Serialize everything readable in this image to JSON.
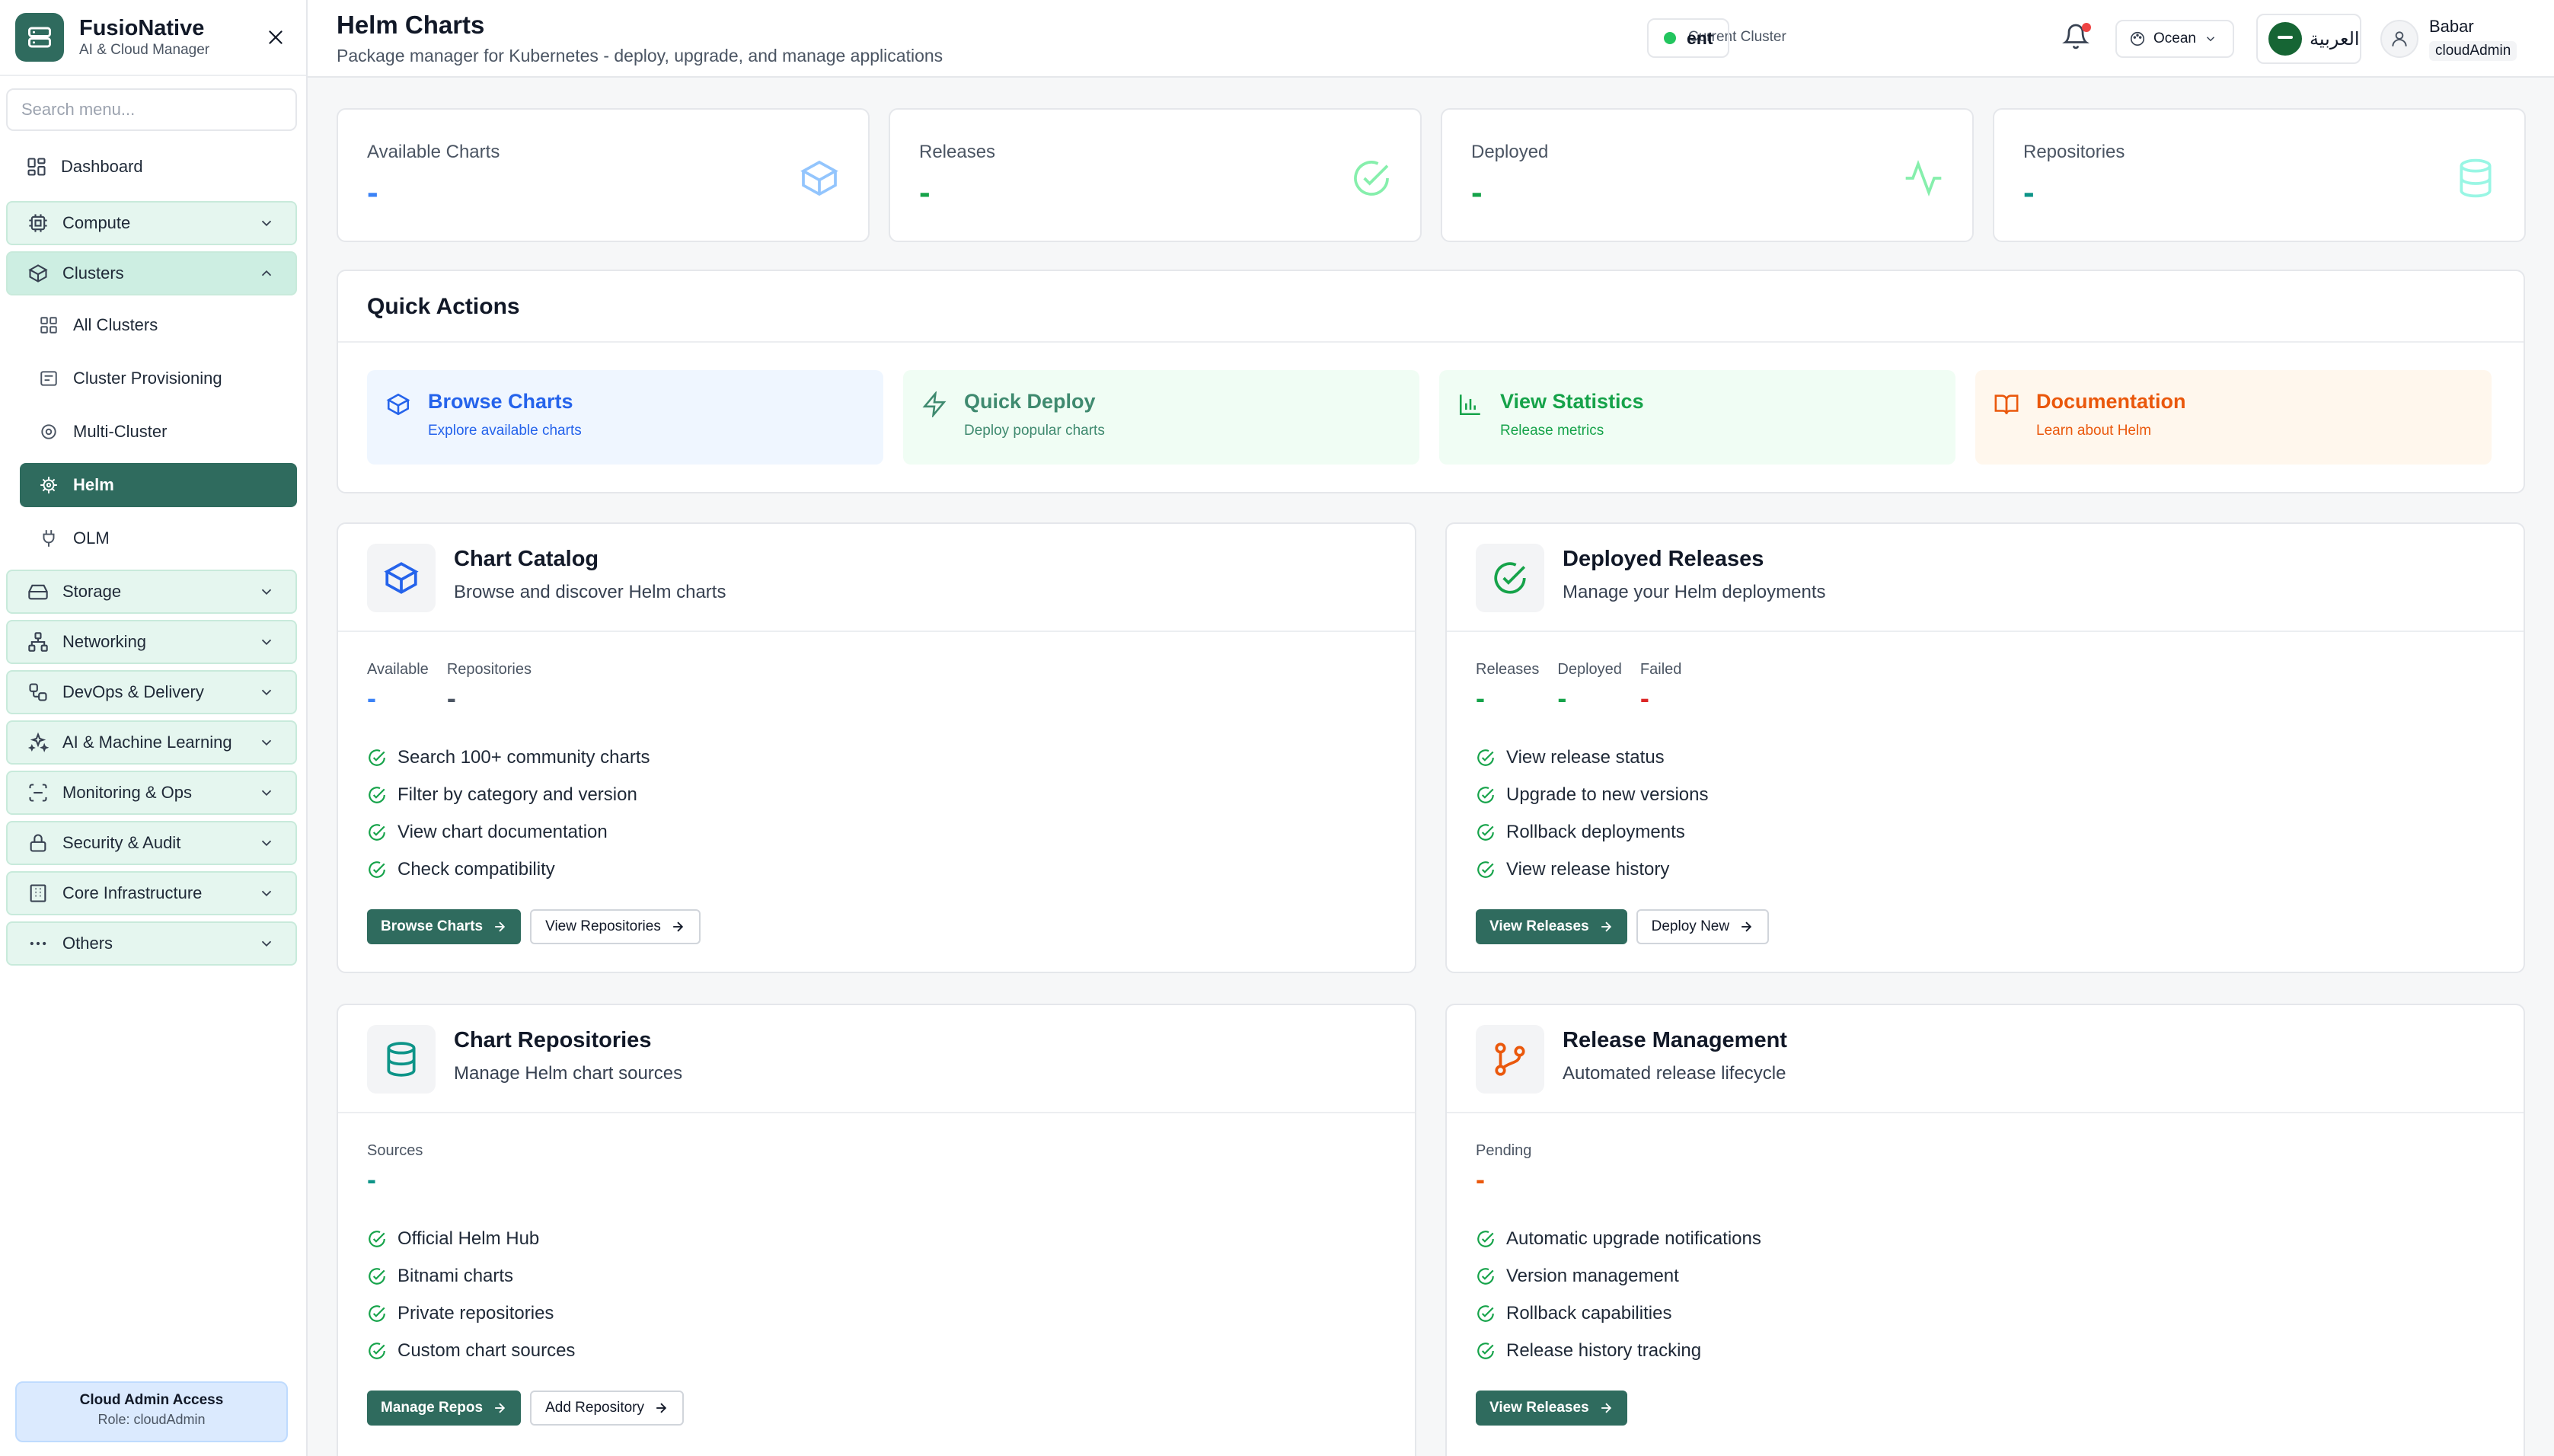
{
  "brand": {
    "name": "FusioNative",
    "subtitle": "AI & Cloud Manager"
  },
  "sidebar": {
    "search_placeholder": "Search menu...",
    "items": {
      "dashboard": "Dashboard",
      "compute": "Compute",
      "clusters": "Clusters",
      "all_clusters": "All Clusters",
      "cluster_provisioning": "Cluster Provisioning",
      "multi_cluster": "Multi-Cluster",
      "helm": "Helm",
      "olm": "OLM",
      "storage": "Storage",
      "networking": "Networking",
      "devops": "DevOps & Delivery",
      "ai_ml": "AI & Machine Learning",
      "monitoring": "Monitoring & Ops",
      "security": "Security & Audit",
      "core_infra": "Core Infrastructure",
      "others": "Others"
    },
    "footer": {
      "title": "Cloud Admin Access",
      "role": "Role: cloudAdmin"
    }
  },
  "header": {
    "title": "Helm Charts",
    "subtitle": "Package manager for Kubernetes - deploy, upgrade, and manage applications",
    "cluster_label": "Current Cluster",
    "cluster_name": "ent",
    "theme": "Ocean",
    "language": "العربية",
    "user_name": "Babar",
    "user_role": "cloudAdmin"
  },
  "stats": [
    {
      "label": "Available Charts",
      "value": "-",
      "color": "#3b82f6"
    },
    {
      "label": "Releases",
      "value": "-",
      "color": "#16a34a"
    },
    {
      "label": "Deployed",
      "value": "-",
      "color": "#16a34a"
    },
    {
      "label": "Repositories",
      "value": "-",
      "color": "#0d9488"
    }
  ],
  "quick_actions": {
    "title": "Quick Actions",
    "items": [
      {
        "name": "Browse Charts",
        "desc": "Explore available charts",
        "color": "#2563eb",
        "bg": "#eff6ff"
      },
      {
        "name": "Quick Deploy",
        "desc": "Deploy popular charts",
        "color": "#3f8a6f",
        "bg": "#f0fdf4"
      },
      {
        "name": "View Statistics",
        "desc": "Release metrics",
        "color": "#16a34a",
        "bg": "#f0fdf4"
      },
      {
        "name": "Documentation",
        "desc": "Learn about Helm",
        "color": "#ea580c",
        "bg": "#fff7ed"
      }
    ]
  },
  "chart_catalog": {
    "title": "Chart Catalog",
    "subtitle": "Browse and discover Helm charts",
    "stats": [
      {
        "label": "Available",
        "value": "-"
      },
      {
        "label": "Repositories",
        "value": "-"
      }
    ],
    "features": [
      "Search 100+ community charts",
      "Filter by category and version",
      "View chart documentation",
      "Check compatibility"
    ],
    "primary_action": "Browse Charts",
    "secondary_action": "View Repositories"
  },
  "deployed_releases": {
    "title": "Deployed Releases",
    "subtitle": "Manage your Helm deployments",
    "stats": [
      {
        "label": "Releases",
        "value": "-"
      },
      {
        "label": "Deployed",
        "value": "-"
      },
      {
        "label": "Failed",
        "value": "-"
      }
    ],
    "features": [
      "View release status",
      "Upgrade to new versions",
      "Rollback deployments",
      "View release history"
    ],
    "primary_action": "View Releases",
    "secondary_action": "Deploy New"
  },
  "chart_repositories": {
    "title": "Chart Repositories",
    "subtitle": "Manage Helm chart sources",
    "stats": [
      {
        "label": "Sources",
        "value": "-"
      }
    ],
    "features": [
      "Official Helm Hub",
      "Bitnami charts",
      "Private repositories",
      "Custom chart sources"
    ],
    "primary_action": "Manage Repos",
    "secondary_action": "Add Repository"
  },
  "release_management": {
    "title": "Release Management",
    "subtitle": "Automated release lifecycle",
    "stats": [
      {
        "label": "Pending",
        "value": "-"
      }
    ],
    "features": [
      "Automatic upgrade notifications",
      "Version management",
      "Rollback capabilities",
      "Release history tracking"
    ],
    "primary_action": "View Releases"
  }
}
